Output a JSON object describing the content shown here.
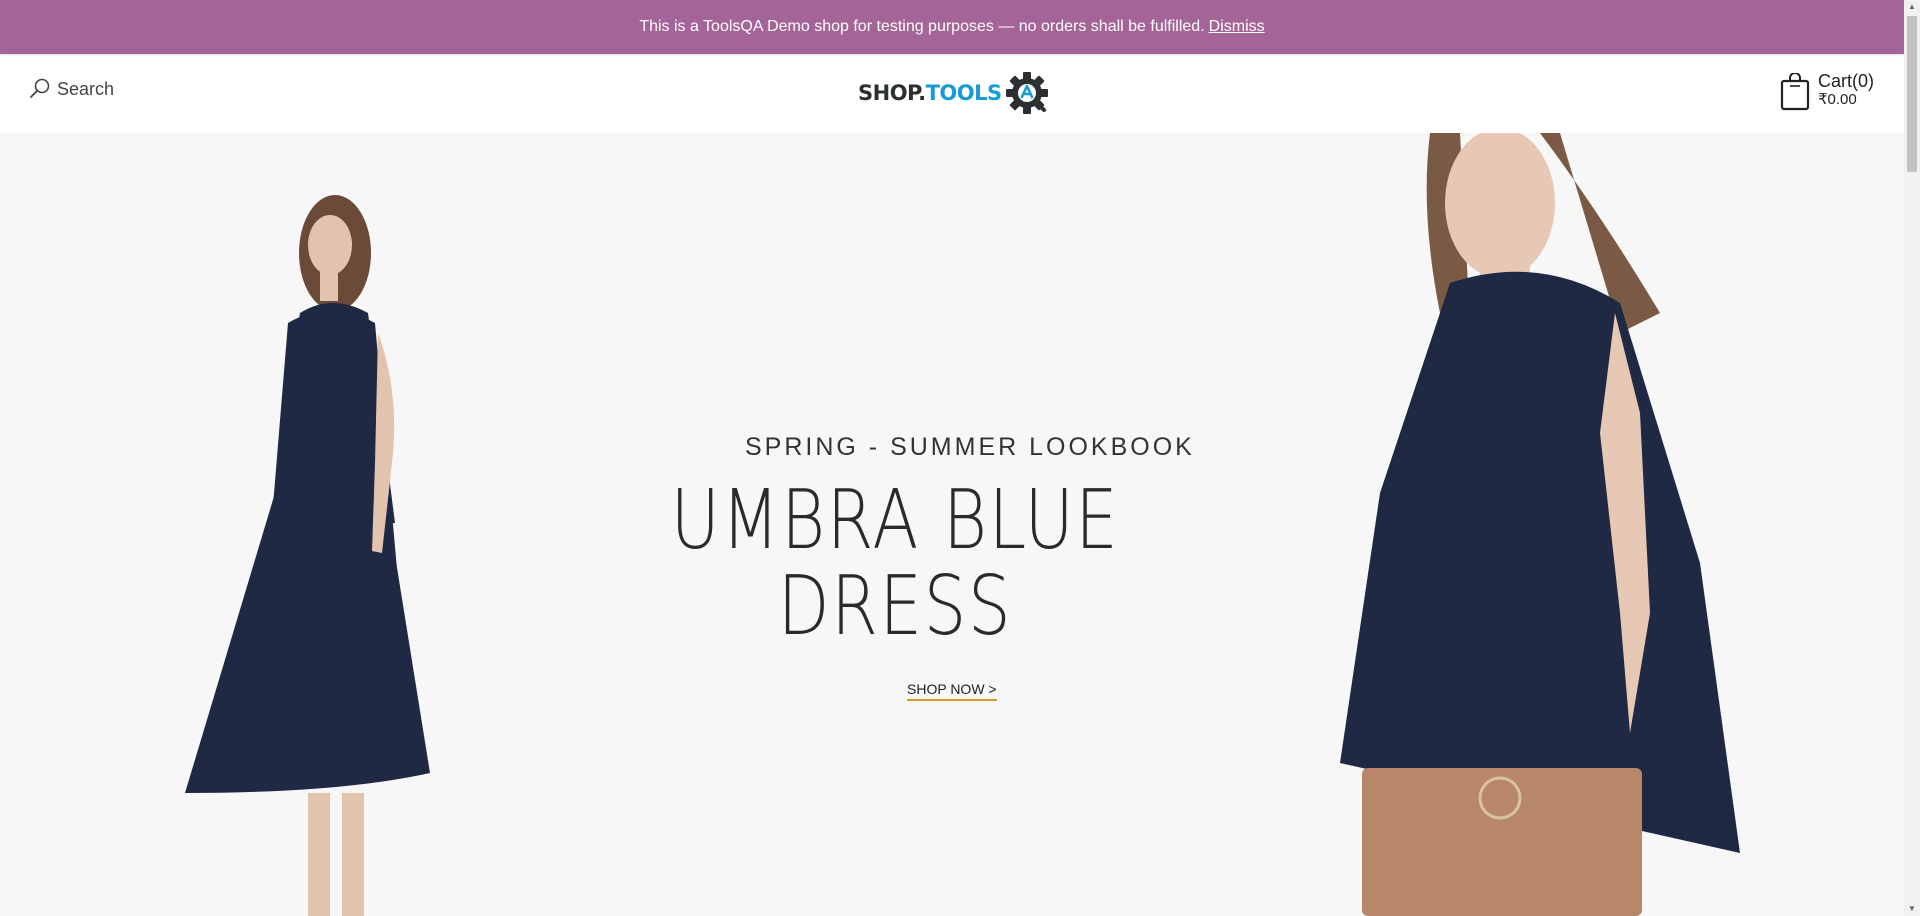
{
  "notice": {
    "text": "This is a ToolsQA Demo shop for testing purposes — no orders shall be fulfilled.",
    "dismiss": "Dismiss"
  },
  "header": {
    "search_label": "Search",
    "logo": {
      "part1": "SHOP.",
      "part2": "TOOLS"
    },
    "cart": {
      "label": "Cart(0)",
      "amount": "₹0.00"
    }
  },
  "hero": {
    "subtitle": "SPRING - SUMMER LOOKBOOK",
    "headline_line1": "UMBRA BLUE",
    "headline_line2": "DRESS",
    "cta": "SHOP NOW >"
  },
  "colors": {
    "notice_bg": "#a46497",
    "accent_underline": "#d49b2a",
    "logo_blue": "#1a9ad6",
    "dress_navy": "#1f2944"
  }
}
